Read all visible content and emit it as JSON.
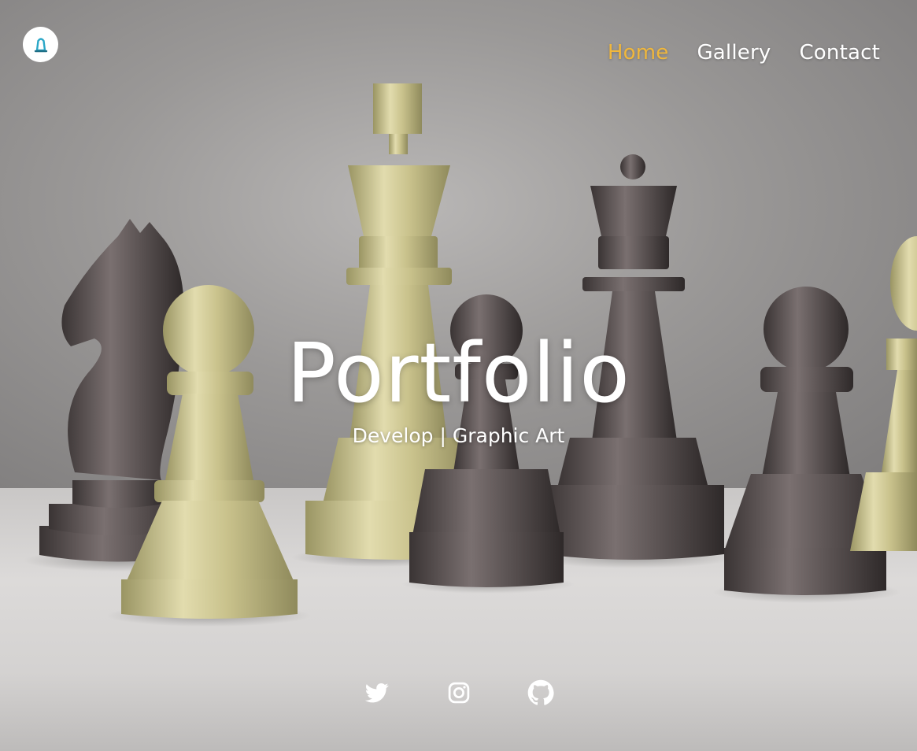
{
  "header": {
    "logo_icon": "bell-icon",
    "nav": [
      {
        "label": "Home",
        "active": true
      },
      {
        "label": "Gallery",
        "active": false
      },
      {
        "label": "Contact",
        "active": false
      }
    ]
  },
  "hero": {
    "title": "Portfolio",
    "subtitle": "Develop | Graphic Art",
    "background": "chess-pieces-image"
  },
  "social": [
    {
      "icon": "twitter-icon"
    },
    {
      "icon": "instagram-icon"
    },
    {
      "icon": "github-icon"
    }
  ],
  "colors": {
    "accent": "#f0b73c",
    "text": "#ffffff",
    "logo_ring": "#2aa7c7"
  }
}
